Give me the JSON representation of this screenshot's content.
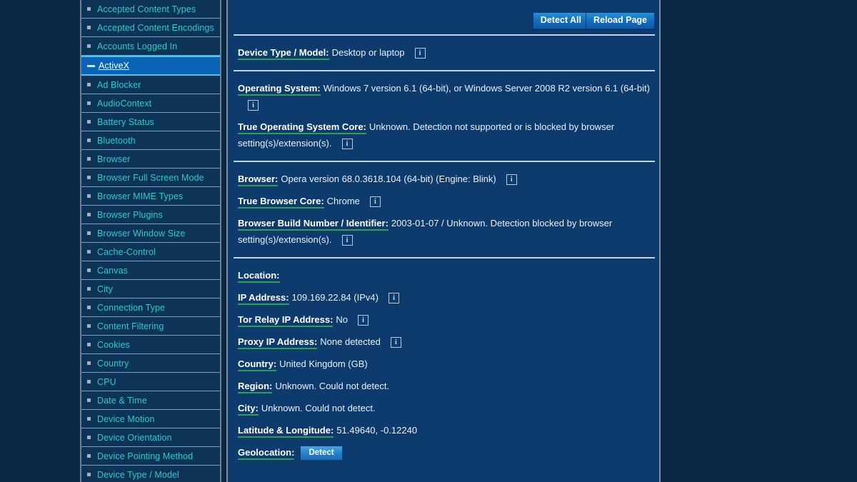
{
  "sidebar": {
    "items": [
      {
        "label": "Accepted Content Types",
        "selected": false
      },
      {
        "label": "Accepted Content Encodings",
        "selected": false
      },
      {
        "label": "Accounts Logged In",
        "selected": false
      },
      {
        "label": "ActiveX",
        "selected": true
      },
      {
        "label": "Ad Blocker",
        "selected": false
      },
      {
        "label": "AudioContext",
        "selected": false
      },
      {
        "label": "Battery Status",
        "selected": false
      },
      {
        "label": "Bluetooth",
        "selected": false
      },
      {
        "label": "Browser",
        "selected": false
      },
      {
        "label": "Browser Full Screen Mode",
        "selected": false
      },
      {
        "label": "Browser MIME Types",
        "selected": false
      },
      {
        "label": "Browser Plugins",
        "selected": false
      },
      {
        "label": "Browser Window Size",
        "selected": false
      },
      {
        "label": "Cache-Control",
        "selected": false
      },
      {
        "label": "Canvas",
        "selected": false
      },
      {
        "label": "City",
        "selected": false
      },
      {
        "label": "Connection Type",
        "selected": false
      },
      {
        "label": "Content Filtering",
        "selected": false
      },
      {
        "label": "Cookies",
        "selected": false
      },
      {
        "label": "Country",
        "selected": false
      },
      {
        "label": "CPU",
        "selected": false
      },
      {
        "label": "Date & Time",
        "selected": false
      },
      {
        "label": "Device Motion",
        "selected": false
      },
      {
        "label": "Device Orientation",
        "selected": false
      },
      {
        "label": "Device Pointing Method",
        "selected": false
      },
      {
        "label": "Device Type / Model",
        "selected": false
      }
    ]
  },
  "toolbar": {
    "detect_all_label": "Detect All",
    "reload_page_label": "Reload Page"
  },
  "info_icon_glyph": "i",
  "sections": {
    "device": [
      {
        "label": "Device Type / Model:",
        "value": "Desktop or laptop",
        "info": true
      }
    ],
    "os": [
      {
        "label": "Operating System:",
        "value": "Windows 7 version 6.1 (64-bit), or Windows Server 2008 R2 version 6.1 (64-bit)",
        "info": true
      },
      {
        "label": "True Operating System Core:",
        "value": "Unknown. Detection not supported or is blocked by browser setting(s)/extension(s).",
        "info": true
      }
    ],
    "browser": [
      {
        "label": "Browser:",
        "value": "Opera version 68.0.3618.104 (64-bit) (Engine: Blink)",
        "info": true
      },
      {
        "label": "True Browser Core:",
        "value": "Chrome",
        "info": true
      },
      {
        "label": "Browser Build Number / Identifier:",
        "value": "2003-01-07 / Unknown. Detection blocked by browser setting(s)/extension(s).",
        "info": true
      }
    ],
    "location": [
      {
        "label": "Location:",
        "value": "",
        "info": false
      },
      {
        "label": "IP Address:",
        "value": "109.169.22.84 (IPv4)",
        "info": true
      },
      {
        "label": "Tor Relay IP Address:",
        "value": "No",
        "info": true
      },
      {
        "label": "Proxy IP Address:",
        "value": "None detected",
        "info": true
      },
      {
        "label": "Country:",
        "value": "United Kingdom (GB)",
        "info": false
      },
      {
        "label": "Region:",
        "value": "Unknown. Could not detect.",
        "info": false
      },
      {
        "label": "City:",
        "value": "Unknown. Could not detect.",
        "info": false
      },
      {
        "label": "Latitude & Longitude:",
        "value": "51.49640, -0.12240",
        "info": false
      },
      {
        "label": "Geolocation:",
        "value": "",
        "button": "Detect",
        "info": false
      }
    ]
  },
  "colors": {
    "page_background": "#0a2744",
    "panel_background": "#0d3b6e",
    "sidebar_background": "#0d3457",
    "sidebar_link": "#34c6c6",
    "sidebar_selected_background": "#0b63b5",
    "label_underline": "#2f9e52",
    "separator": "#c3d3e8",
    "button_blue": "#1470c0"
  }
}
